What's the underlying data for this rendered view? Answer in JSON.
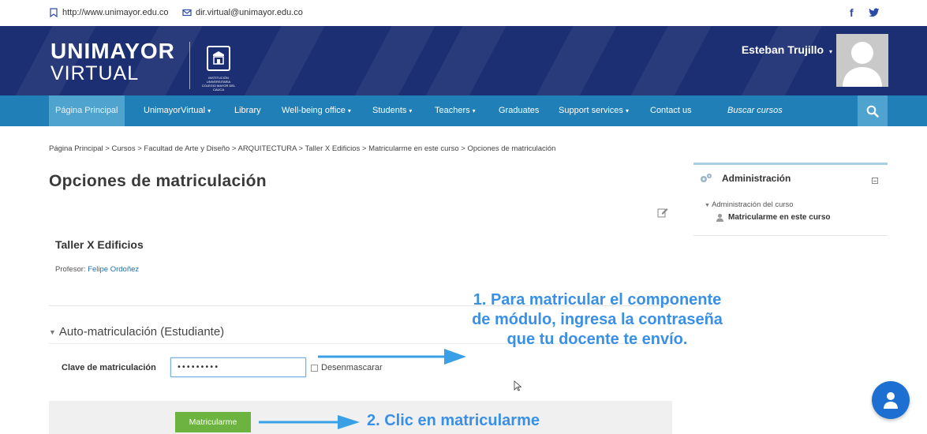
{
  "topbar": {
    "website": "http://www.unimayor.edu.co",
    "email": "dir.virtual@unimayor.edu.co",
    "facebook_icon": "f"
  },
  "header": {
    "logo_line1": "UNIMAYOR",
    "logo_line2": "VIRTUAL",
    "seal_caption": "INSTITUCIÓN UNIVERSITARIA COLEGIO MAYOR DEL CAUCA",
    "user_name": "Esteban Trujillo",
    "user_caret": "▾"
  },
  "nav": {
    "items": [
      {
        "label": "Página Principal",
        "dropdown": false,
        "active": true
      },
      {
        "label": "UnimayorVirtual",
        "dropdown": true
      },
      {
        "label": "Library",
        "dropdown": false
      },
      {
        "label": "Well-being office",
        "dropdown": true
      },
      {
        "label": "Students",
        "dropdown": true
      },
      {
        "label": "Teachers",
        "dropdown": true
      },
      {
        "label": "Graduates",
        "dropdown": false
      },
      {
        "label": "Support services",
        "dropdown": true
      },
      {
        "label": "Contact us",
        "dropdown": false
      }
    ],
    "search_placeholder": "Buscar cursos",
    "caret": "▾"
  },
  "breadcrumb": "Página Principal > Cursos > Facultad de Arte y Diseño > ARQUITECTURA > Taller X Edificios > Matricularme en este curso > Opciones de matriculación",
  "page_title": "Opciones de matriculación",
  "admin_block": {
    "title": "Administración",
    "subtitle": "Administración del curso",
    "link": "Matricularme en este curso"
  },
  "course": {
    "name": "Taller X Edificios",
    "teacher_label": "Profesor:",
    "teacher_name": "Felipe Ordoñez"
  },
  "enrol": {
    "section_title": "Auto-matriculación (Estudiante)",
    "key_label": "Clave de matriculación",
    "key_value": "•••••••••",
    "unmask_label": "Desenmascarar",
    "submit_label": "Matricularme"
  },
  "annotations": {
    "note1": "1. Para matricular el componente de módulo, ingresa la contraseña que tu docente te envío.",
    "note2": "2. Clic en matricularme"
  },
  "colors": {
    "header": "#1c2f73",
    "nav": "#1f7fb6",
    "nav_active": "#4fa3cf",
    "submit": "#6db33f",
    "annotation": "#3a8fe6"
  }
}
